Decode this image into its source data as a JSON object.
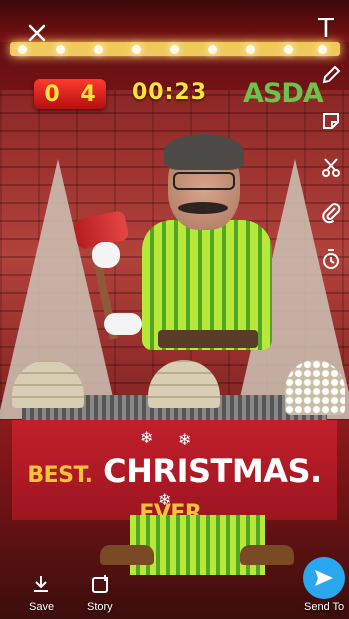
{
  "game": {
    "score_digit_1": "0",
    "score_digit_2": "4",
    "timer": "00:23",
    "brand": "ASDA",
    "banner": {
      "word1": "BEST.",
      "word2": "CHRISTMAS.",
      "word3": "EVER."
    }
  },
  "toolbar_right": {
    "text_icon": "T"
  },
  "bottom_bar": {
    "save_label": "Save",
    "story_label": "Story",
    "send_label": "Send To"
  },
  "colors": {
    "accent_score": "#e52222",
    "timer": "#ffe23c",
    "brand": "#6cc24a",
    "send_button": "#2aa7ee"
  }
}
